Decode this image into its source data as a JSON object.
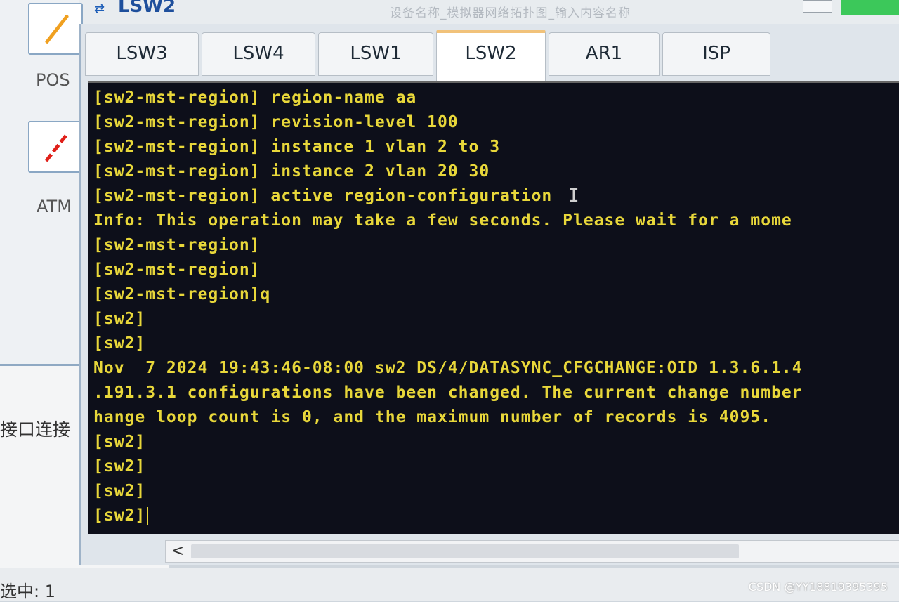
{
  "window": {
    "title": "LSW2"
  },
  "background": {
    "top_blurred_text": "设备名称_模拟器网络拓扑图_输入内容名称",
    "devices": [
      {
        "label": "POS"
      },
      {
        "label": "ATM"
      }
    ],
    "interface_label": "接口连接",
    "status": "选中: 1",
    "watermark": "CSDN @YY18819395395"
  },
  "tabs": [
    {
      "label": "LSW3"
    },
    {
      "label": "LSW4"
    },
    {
      "label": "LSW1"
    },
    {
      "label": "LSW2",
      "active": true
    },
    {
      "label": "AR1"
    },
    {
      "label": "ISP"
    }
  ],
  "terminal": {
    "lines": [
      "[sw2-mst-region] region-name aa",
      "[sw2-mst-region] revision-level 100",
      "[sw2-mst-region] instance 1 vlan 2 to 3",
      "[sw2-mst-region] instance 2 vlan 20 30",
      "[sw2-mst-region] active region-configuration",
      "Info: This operation may take a few seconds. Please wait for a mome",
      "[sw2-mst-region]",
      "[sw2-mst-region]",
      "[sw2-mst-region]q",
      "[sw2]",
      "[sw2]",
      "Nov  7 2024 19:43:46-08:00 sw2 DS/4/DATASYNC_CFGCHANGE:OID 1.3.6.1.4",
      ".191.3.1 configurations have been changed. The current change number",
      "hange loop count is 0, and the maximum number of records is 4095.",
      "[sw2]",
      "[sw2]",
      "[sw2]",
      "[sw2]"
    ],
    "text_color": "#e8d73a",
    "background_color": "#0d0f1a"
  },
  "scrollbar": {
    "left_arrow": "<"
  }
}
